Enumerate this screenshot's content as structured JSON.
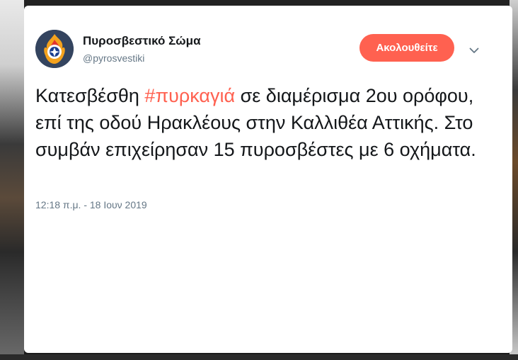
{
  "account": {
    "display_name": "Πυροσβεστικό Σώμα",
    "handle": "@pyrosvestiki",
    "avatar_icon": "fire-service-emblem-icon"
  },
  "actions": {
    "follow_label": "Ακολουθείτε",
    "more_icon": "chevron-down-icon"
  },
  "tweet": {
    "text_before": "Κατεσβέσθη ",
    "hashtag": "#πυρκαγιά",
    "text_after": " σε διαμέρισμα 2ου ορόφου, επί της οδού Ηρακλέους στην Καλλιθέα Αττικής. Στο συμβάν επιχείρησαν 15 πυροσβέστες με 6 οχήματα.",
    "timestamp": "12:18 π.μ. - 18 Ιουν 2019"
  },
  "colors": {
    "accent": "#ff6150",
    "text_primary": "#14171a",
    "text_secondary": "#657786"
  }
}
